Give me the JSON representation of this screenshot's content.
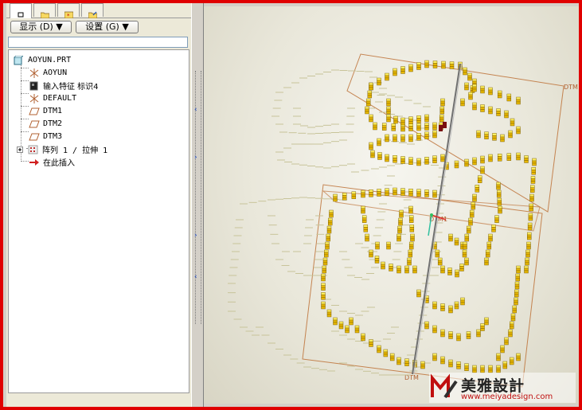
{
  "tabs": [
    {
      "icon": "model-tree-tab-icon"
    },
    {
      "icon": "folder-browser-tab-icon"
    },
    {
      "icon": "favorites-tab-icon"
    },
    {
      "icon": "connections-tab-icon"
    }
  ],
  "toolbar": {
    "show_label": "显示 (D) ▼",
    "settings_label": "设置 (G) ▼"
  },
  "search": {
    "value": ""
  },
  "model_tree": {
    "root": "AOYUN.PRT",
    "items": [
      {
        "label": "AOYUN",
        "icon": "coordinate-system-icon"
      },
      {
        "label": "输入特征 标识4",
        "icon": "imported-feature-icon"
      },
      {
        "label": "DEFAULT",
        "icon": "coordinate-system-icon"
      },
      {
        "label": "DTM1",
        "icon": "datum-plane-icon"
      },
      {
        "label": "DTM2",
        "icon": "datum-plane-icon"
      },
      {
        "label": "DTM3",
        "icon": "datum-plane-icon"
      },
      {
        "label": "阵列 1 / 拉伸 1",
        "icon": "pattern-icon"
      },
      {
        "label": "在此插入",
        "icon": "insert-here-arrow-icon"
      }
    ]
  },
  "viewport": {
    "datum_labels": [
      "DTM",
      "DTM",
      "DTM1"
    ],
    "accent_color": "#e8b800",
    "frame_color": "#c07840"
  },
  "watermark": {
    "name": "美雅設計",
    "url": "www.meiyadesign.com"
  }
}
